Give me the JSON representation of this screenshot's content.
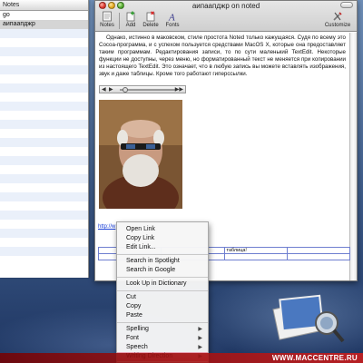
{
  "drawer": {
    "header": "Notes",
    "items": [
      {
        "label": "go"
      },
      {
        "label": "аипаапджр"
      }
    ]
  },
  "window": {
    "title": "аипаапджр on noted",
    "toolbar": {
      "notes": "Notes",
      "add": "Add",
      "delete": "Delete",
      "fonts": "Fonts",
      "customize": "Customize"
    }
  },
  "content": {
    "paragraph": "Однако, истинно в маковском, стиле простота Noted только кажущаяся. Судя по всему это Cocoa-программа, и с успехом пользуется средствами MacOS X, которые она предоставляет таким программам. Редактирования записи, то по сути маленький TextEdit. Некоторые функции не доступны, через меню, но форматированный текст не меняется при копировании из настоящего TextEdit. Это означает, что в любую запись вы можете вставлять изображения, звук и даже таблицы. Кроме того работают гиперссылки.",
    "link": "http://w",
    "table_cell": "таблица!",
    "player_progress": 0.1
  },
  "context_menu": {
    "items": [
      {
        "label": "Open Link",
        "type": "item"
      },
      {
        "label": "Copy Link",
        "type": "item"
      },
      {
        "label": "Edit Link...",
        "type": "item"
      },
      {
        "type": "separator"
      },
      {
        "label": "Search in Spotlight",
        "type": "item"
      },
      {
        "label": "Search in Google",
        "type": "item"
      },
      {
        "type": "separator"
      },
      {
        "label": "Look Up in Dictionary",
        "type": "item"
      },
      {
        "type": "separator"
      },
      {
        "label": "Cut",
        "type": "item"
      },
      {
        "label": "Copy",
        "type": "item"
      },
      {
        "label": "Paste",
        "type": "item"
      },
      {
        "type": "separator"
      },
      {
        "label": "Spelling",
        "type": "submenu"
      },
      {
        "label": "Font",
        "type": "submenu"
      },
      {
        "label": "Speech",
        "type": "submenu"
      },
      {
        "label": "Writing Direction",
        "type": "submenu",
        "highlighted": true
      }
    ]
  },
  "watermark": "WWW.MACCENTRE.RU",
  "colors": {
    "link": "#1a3fd8",
    "table_border": "#6f7fd0",
    "menu_highlight": "#d98099",
    "watermark_bg": "#c81e1e"
  },
  "icons": [
    "notes-icon",
    "add-icon",
    "delete-icon",
    "fonts-icon",
    "customize-icon",
    "play-icon",
    "volume-icon",
    "preview-icon"
  ]
}
